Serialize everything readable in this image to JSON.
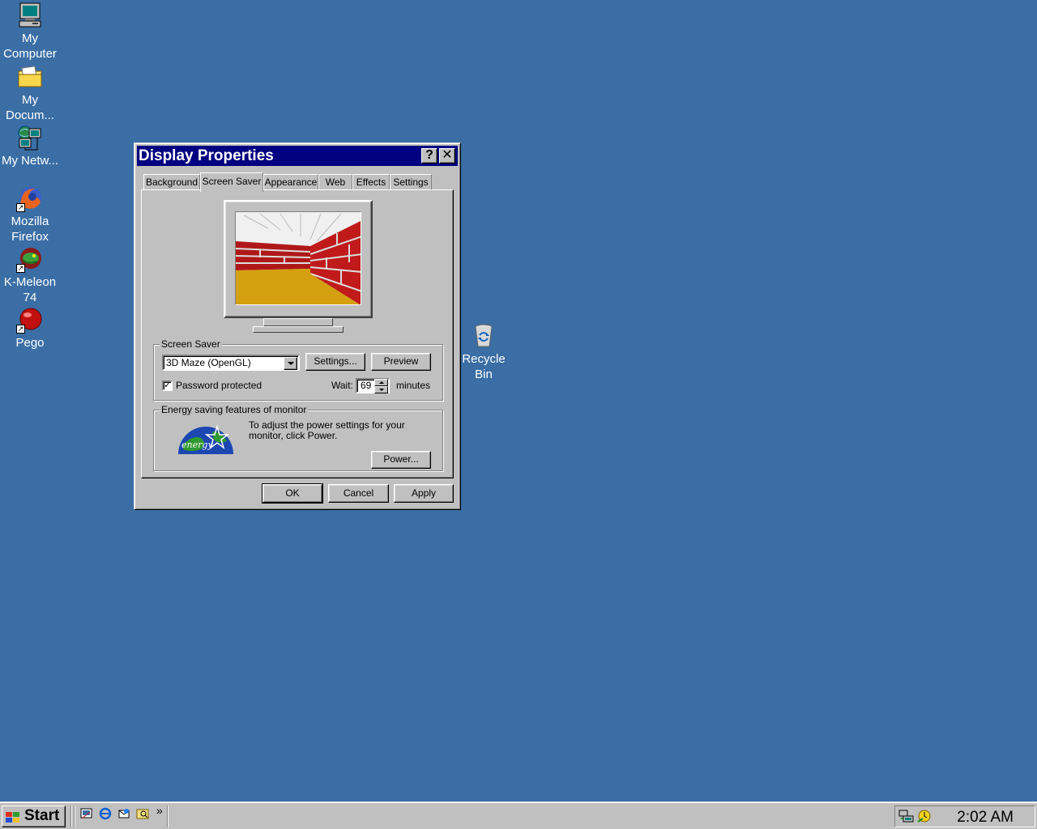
{
  "desktop": {
    "icons": [
      {
        "name": "my-computer",
        "label": "My Computer"
      },
      {
        "name": "my-documents",
        "label": "My Docum..."
      },
      {
        "name": "my-network",
        "label": "My Netw..."
      },
      {
        "name": "mozilla-firefox",
        "label": "Mozilla Firefox"
      },
      {
        "name": "k-meleon",
        "label": "K-Meleon 74"
      },
      {
        "name": "pego",
        "label": "Pego"
      },
      {
        "name": "recycle-bin",
        "label": "Recycle Bin"
      }
    ],
    "background_color": "#3a6ea5"
  },
  "window": {
    "title": "Display Properties",
    "help_glyph": "?",
    "close_glyph": "✕",
    "tabs": [
      "Background",
      "Screen Saver",
      "Appearance",
      "Web",
      "Effects",
      "Settings"
    ],
    "active_tab": "Screen Saver",
    "screen_saver": {
      "group_title": "Screen Saver",
      "selected": "3D Maze (OpenGL)",
      "settings_label": "Settings...",
      "preview_label": "Preview",
      "password_label": "Password protected",
      "password_checked": true,
      "wait_label": "Wait:",
      "wait_value": "69",
      "minutes_label": "minutes"
    },
    "energy": {
      "group_title": "Energy saving features of monitor",
      "description": "To adjust the power settings for your monitor, click Power.",
      "power_label": "Power...",
      "logo_text": "energy"
    },
    "buttons": {
      "ok": "OK",
      "cancel": "Cancel",
      "apply": "Apply"
    }
  },
  "taskbar": {
    "start_label": "Start",
    "chevron": "»",
    "clock": "2:02 AM",
    "quick_launch": [
      "show-desktop-icon",
      "internet-explorer-icon",
      "outlook-express-icon",
      "windows-explorer-icon"
    ]
  }
}
